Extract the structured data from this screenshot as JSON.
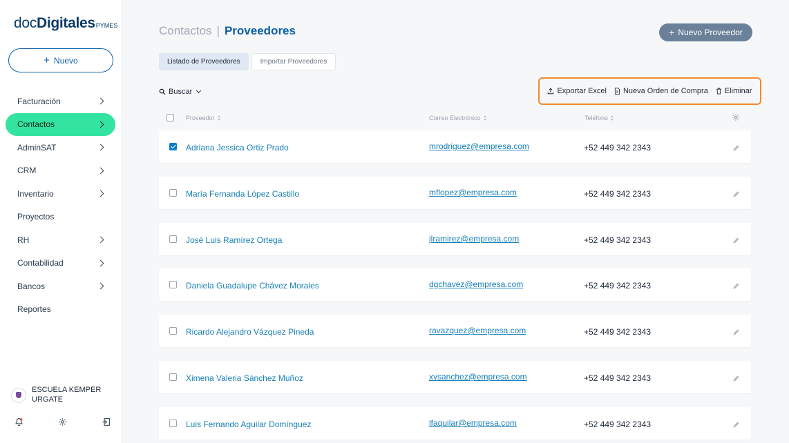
{
  "logo": {
    "part1": "doc",
    "part2": "Digitales",
    "part3": "PYMES"
  },
  "sidebar": {
    "new_button": "Nuevo",
    "items": [
      {
        "label": "Facturación",
        "arrow": true,
        "active": false
      },
      {
        "label": "Contactos",
        "arrow": true,
        "active": true
      },
      {
        "label": "AdminSAT",
        "arrow": true,
        "active": false
      },
      {
        "label": "CRM",
        "arrow": true,
        "active": false
      },
      {
        "label": "Inventario",
        "arrow": true,
        "active": false
      },
      {
        "label": "Proyectos",
        "arrow": false,
        "active": false
      },
      {
        "label": "RH",
        "arrow": true,
        "active": false
      },
      {
        "label": "Contabilidad",
        "arrow": true,
        "active": false
      },
      {
        "label": "Bancos",
        "arrow": true,
        "active": false
      },
      {
        "label": "Reportes",
        "arrow": false,
        "active": false
      }
    ],
    "organization": {
      "line1": "ESCUELA KEMPER",
      "line2": "URGATE"
    },
    "footer_icons": [
      "bell-icon",
      "gear-icon",
      "logout-icon"
    ]
  },
  "header": {
    "breadcrumb_parent": "Contactos",
    "breadcrumb_separator": "|",
    "breadcrumb_current": "Proveedores",
    "new_supplier_button": "Nuevo Proveedor"
  },
  "tabs": [
    {
      "label": "Listado de Proveedores",
      "active": true
    },
    {
      "label": "Importar Proveedores",
      "active": false
    }
  ],
  "toolbar": {
    "search_label": "Buscar",
    "export_label": "Exportar Excel",
    "purchase_order_label": "Nueva Orden de Compra",
    "delete_label": "Eliminar"
  },
  "table": {
    "columns": {
      "supplier": "Proveedor",
      "email": "Correo Electrónico",
      "phone": "Teléfono"
    },
    "rows": [
      {
        "name": "Adriana Jessica Ortiz Prado",
        "email": "mrodriguez@empresa.com",
        "phone": "+52 449 342 2343",
        "checked": true
      },
      {
        "name": "María Fernanda López Castillo",
        "email": "mflopez@empresa.com",
        "phone": "+52 449 342 2343",
        "checked": false
      },
      {
        "name": "José Luis Ramírez Ortega",
        "email": "jlramirez@empresa.com",
        "phone": "+52 449 342 2343",
        "checked": false
      },
      {
        "name": "Daniela Guadalupe Chávez Morales",
        "email": "dgchavez@empresa.com",
        "phone": "+52 449 342 2343",
        "checked": false
      },
      {
        "name": "Ricardo Alejandro Vázquez Pineda",
        "email": "ravazquez@empresa.com",
        "phone": "+52 449 342 2343",
        "checked": false
      },
      {
        "name": "Ximena Valeria Sánchez Muñoz",
        "email": "xvsanchez@empresa.com",
        "phone": "+52 449 342 2343",
        "checked": false
      },
      {
        "name": "Luis Fernando Aguilar Domínguez",
        "email": "lfaquilar@empresa.com",
        "phone": "+52 449 342 2343",
        "checked": false
      }
    ]
  },
  "colors": {
    "accent": "#0b5fa5",
    "active_nav": "#33e3a0",
    "link": "#1780b8",
    "highlight_border": "#f28a2e",
    "primary_button": "#6b8199"
  }
}
